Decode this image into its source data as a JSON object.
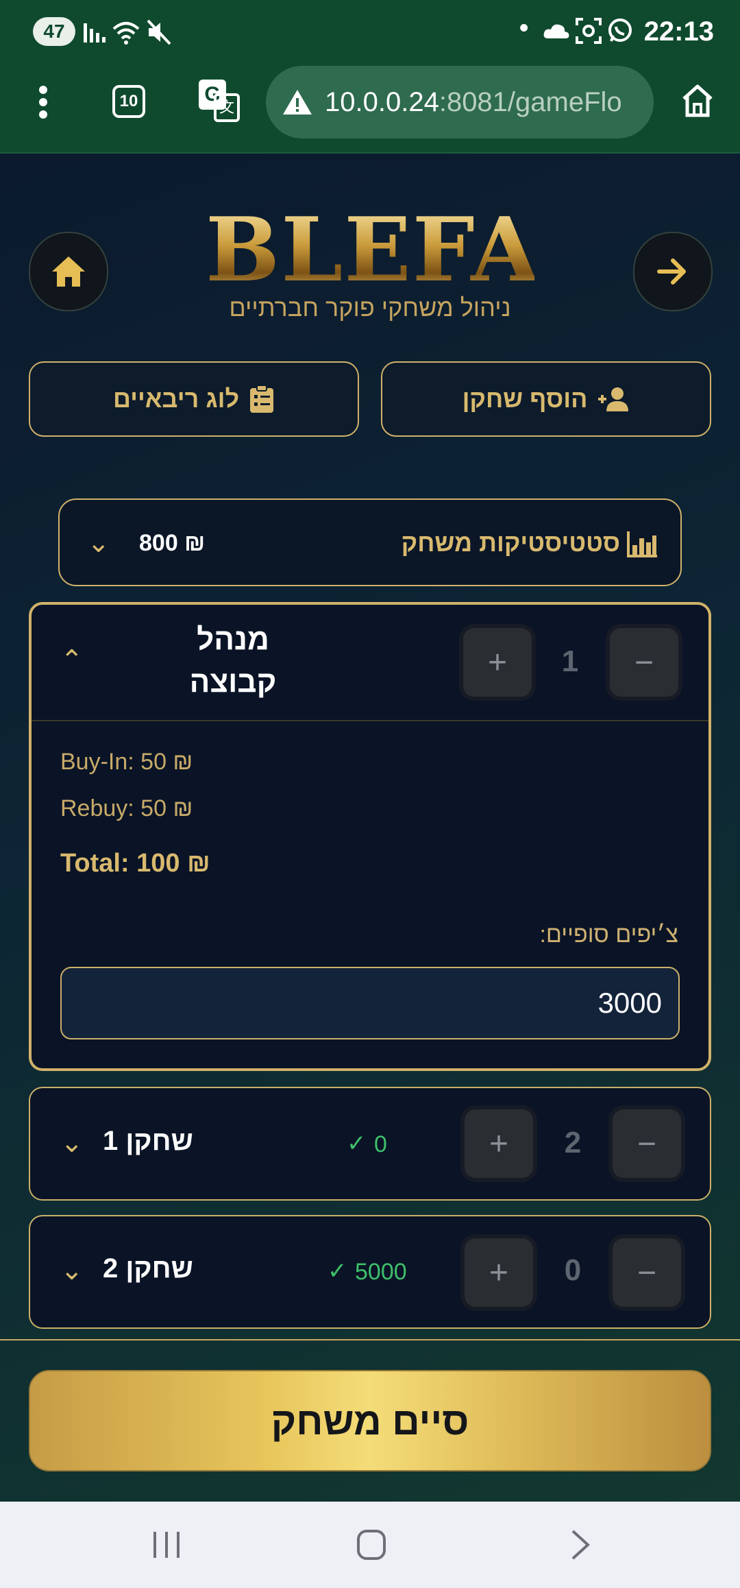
{
  "status_bar": {
    "battery": "47",
    "time": "22:13",
    "dot": "•"
  },
  "browser": {
    "tab_count": "10",
    "url_host": "10.0.0.24",
    "url_rest": ":8081/gameFlo"
  },
  "header": {
    "title": "BLEFA",
    "subtitle": "ניהול משחקי פוקר חברתיים"
  },
  "actions": {
    "add_player": "הוסף שחקן",
    "rebuy_log": "לוג ריבאיים"
  },
  "stats": {
    "label": "סטטיסטיקות משחק",
    "amount": "₪ 800"
  },
  "manager_card": {
    "name_line1": "מנהל",
    "name_line2": "קבוצה",
    "count": "1",
    "buy_in": "Buy-In: 50 ₪",
    "rebuy": "Rebuy: 50 ₪",
    "total": "Total: 100 ₪",
    "final_chips_label": "צ׳יפים סופיים:",
    "final_chips_value": "3000"
  },
  "players": [
    {
      "name": "שחקן 1",
      "chips": "0",
      "count": "2"
    },
    {
      "name": "שחקן 2",
      "chips": "5000",
      "count": "0"
    }
  ],
  "footer": {
    "end_game": "סיים משחק"
  },
  "colors": {
    "gold": "#d8b96e",
    "chrome_green": "#0f4a2e",
    "success": "#3fbf6b"
  }
}
